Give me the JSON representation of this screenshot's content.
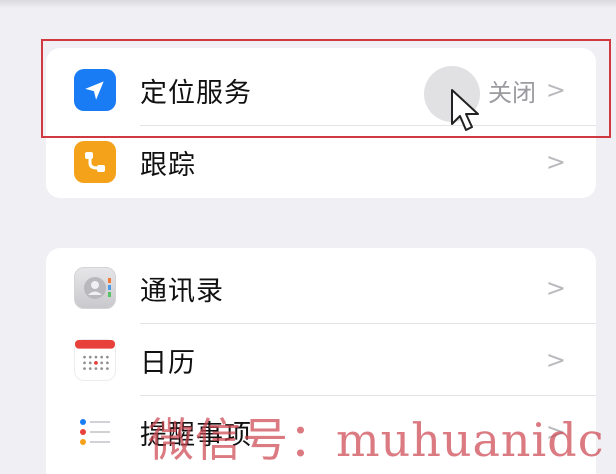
{
  "section1": {
    "items": [
      {
        "label": "定位服务",
        "value": "关闭",
        "icon": "location-arrow-icon",
        "color": "#1a7cf5"
      },
      {
        "label": "跟踪",
        "icon": "tracking-icon",
        "color": "#f5a21b"
      }
    ]
  },
  "section2": {
    "items": [
      {
        "label": "通讯录",
        "icon": "contacts-icon"
      },
      {
        "label": "日历",
        "icon": "calendar-icon"
      },
      {
        "label": "提醒事项",
        "icon": "reminders-icon"
      }
    ]
  },
  "chevron": ">",
  "watermark": "微信号：muhuanidc",
  "colors": {
    "highlight": "#d0393f",
    "background": "#efeff4",
    "accent": "#1a7cf5"
  }
}
